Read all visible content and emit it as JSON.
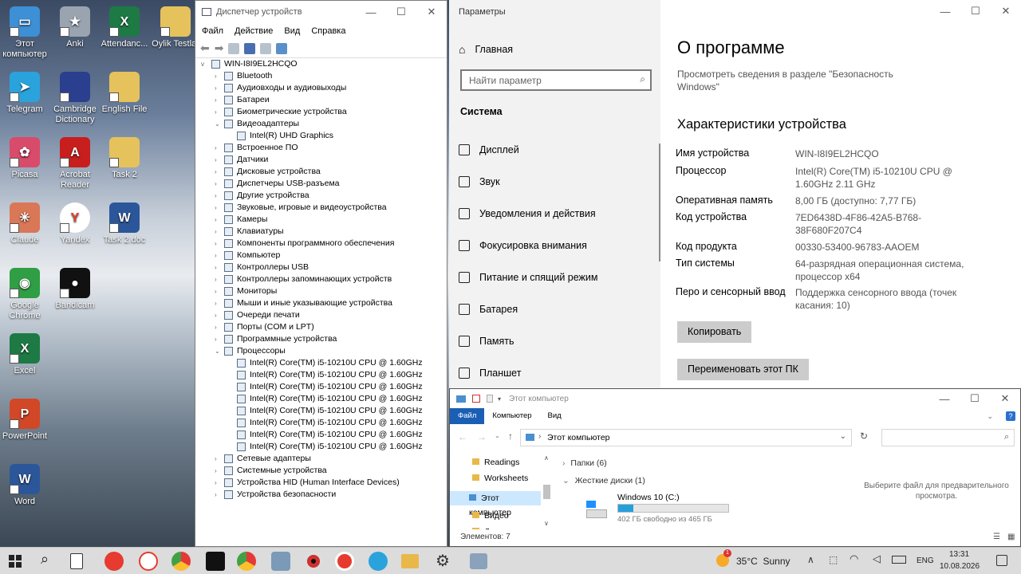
{
  "desktop": {
    "icons": [
      {
        "label": "Этот компьютер",
        "color": "#3d8fd6",
        "glyph": "▭"
      },
      {
        "label": "Anki",
        "color": "#9aa4b0",
        "glyph": "★"
      },
      {
        "label": "Attendanc...",
        "color": "#1d7a44",
        "glyph": "X"
      },
      {
        "label": "Oylik Testlar",
        "color": "#e6c25c",
        "glyph": ""
      },
      {
        "label": "Telegram",
        "color": "#2aa3dd",
        "glyph": "➤"
      },
      {
        "label": "Cambridge Dictionary",
        "color": "#2b3f8f",
        "glyph": ""
      },
      {
        "label": "English File",
        "color": "#e6c25c",
        "glyph": ""
      },
      {
        "label": "Picasa",
        "color": "#d94b6a",
        "glyph": "✿"
      },
      {
        "label": "Acrobat Reader",
        "color": "#c81e1e",
        "glyph": "A"
      },
      {
        "label": "Task 2",
        "color": "#e6c25c",
        "glyph": ""
      },
      {
        "label": "Claude",
        "color": "#d97757",
        "glyph": "✳"
      },
      {
        "label": "Yandex",
        "color": "#ffffff",
        "glyph": "Y"
      },
      {
        "label": "Task 2.doc",
        "color": "#2b579a",
        "glyph": "W"
      },
      {
        "label": "Google Chrome",
        "color": "#2f9e44",
        "glyph": "◉"
      },
      {
        "label": "Bandicam",
        "color": "#111111",
        "glyph": "●"
      },
      {
        "label": "Excel",
        "color": "#1d7a44",
        "glyph": "X"
      },
      {
        "label": "PowerPoint",
        "color": "#d24726",
        "glyph": "P"
      },
      {
        "label": "Word",
        "color": "#2b579a",
        "glyph": "W"
      }
    ]
  },
  "devmgr": {
    "title": "Диспетчер устройств",
    "menu": [
      "Файл",
      "Действие",
      "Вид",
      "Справка"
    ],
    "root": "WIN-I8I9EL2HCQO",
    "items": [
      {
        "text": "Bluetooth",
        "lvl": 1,
        "exp": ">"
      },
      {
        "text": "Аудиовходы и аудиовыходы",
        "lvl": 1,
        "exp": ">"
      },
      {
        "text": "Батареи",
        "lvl": 1,
        "exp": ">"
      },
      {
        "text": "Биометрические устройства",
        "lvl": 1,
        "exp": ">"
      },
      {
        "text": "Видеоадаптеры",
        "lvl": 1,
        "exp": "v"
      },
      {
        "text": "Intel(R) UHD Graphics",
        "lvl": 2,
        "exp": ""
      },
      {
        "text": "Встроенное ПО",
        "lvl": 1,
        "exp": ">"
      },
      {
        "text": "Датчики",
        "lvl": 1,
        "exp": ">"
      },
      {
        "text": "Дисковые устройства",
        "lvl": 1,
        "exp": ">"
      },
      {
        "text": "Диспетчеры USB-разъема",
        "lvl": 1,
        "exp": ">"
      },
      {
        "text": "Другие устройства",
        "lvl": 1,
        "exp": ">"
      },
      {
        "text": "Звуковые, игровые и видеоустройства",
        "lvl": 1,
        "exp": ">"
      },
      {
        "text": "Камеры",
        "lvl": 1,
        "exp": ">"
      },
      {
        "text": "Клавиатуры",
        "lvl": 1,
        "exp": ">"
      },
      {
        "text": "Компоненты программного обеспечения",
        "lvl": 1,
        "exp": ">"
      },
      {
        "text": "Компьютер",
        "lvl": 1,
        "exp": ">"
      },
      {
        "text": "Контроллеры USB",
        "lvl": 1,
        "exp": ">"
      },
      {
        "text": "Контроллеры запоминающих устройств",
        "lvl": 1,
        "exp": ">"
      },
      {
        "text": "Мониторы",
        "lvl": 1,
        "exp": ">"
      },
      {
        "text": "Мыши и иные указывающие устройства",
        "lvl": 1,
        "exp": ">"
      },
      {
        "text": "Очереди печати",
        "lvl": 1,
        "exp": ">"
      },
      {
        "text": "Порты (COM и LPT)",
        "lvl": 1,
        "exp": ">"
      },
      {
        "text": "Программные устройства",
        "lvl": 1,
        "exp": ">"
      },
      {
        "text": "Процессоры",
        "lvl": 1,
        "exp": "v"
      },
      {
        "text": "Intel(R) Core(TM) i5-10210U CPU @ 1.60GHz",
        "lvl": 2,
        "exp": ""
      },
      {
        "text": "Intel(R) Core(TM) i5-10210U CPU @ 1.60GHz",
        "lvl": 2,
        "exp": ""
      },
      {
        "text": "Intel(R) Core(TM) i5-10210U CPU @ 1.60GHz",
        "lvl": 2,
        "exp": ""
      },
      {
        "text": "Intel(R) Core(TM) i5-10210U CPU @ 1.60GHz",
        "lvl": 2,
        "exp": ""
      },
      {
        "text": "Intel(R) Core(TM) i5-10210U CPU @ 1.60GHz",
        "lvl": 2,
        "exp": ""
      },
      {
        "text": "Intel(R) Core(TM) i5-10210U CPU @ 1.60GHz",
        "lvl": 2,
        "exp": ""
      },
      {
        "text": "Intel(R) Core(TM) i5-10210U CPU @ 1.60GHz",
        "lvl": 2,
        "exp": ""
      },
      {
        "text": "Intel(R) Core(TM) i5-10210U CPU @ 1.60GHz",
        "lvl": 2,
        "exp": ""
      },
      {
        "text": "Сетевые адаптеры",
        "lvl": 1,
        "exp": ">"
      },
      {
        "text": "Системные устройства",
        "lvl": 1,
        "exp": ">"
      },
      {
        "text": "Устройства HID (Human Interface Devices)",
        "lvl": 1,
        "exp": ">"
      },
      {
        "text": "Устройства безопасности",
        "lvl": 1,
        "exp": ">"
      }
    ]
  },
  "settings": {
    "title": "Параметры",
    "home": "Главная",
    "search_placeholder": "Найти параметр",
    "section": "Система",
    "nav": [
      "Дисплей",
      "Звук",
      "Уведомления и действия",
      "Фокусировка внимания",
      "Питание и спящий режим",
      "Батарея",
      "Память",
      "Планшет"
    ],
    "page_title": "О программе",
    "security_note": "Просмотреть сведения в разделе \"Безопасность Windows\"",
    "specs_title": "Характеристики устройства",
    "specs": [
      {
        "label": "Имя устройства",
        "value": "WIN-I8I9EL2HCQO"
      },
      {
        "label": "Процессор",
        "value": "Intel(R) Core(TM) i5-10210U CPU @ 1.60GHz   2.11 GHz"
      },
      {
        "label": "Оперативная память",
        "value": "8,00 ГБ (доступно: 7,77 ГБ)"
      },
      {
        "label": "Код устройства",
        "value": "7ED6438D-4F86-42A5-B768-38F680F207C4"
      },
      {
        "label": "Код продукта",
        "value": "00330-53400-96783-AAOEM"
      },
      {
        "label": "Тип системы",
        "value": "64-разрядная операционная система, процессор x64"
      },
      {
        "label": "Перо и сенсорный ввод",
        "value": "Поддержка сенсорного ввода (точек касания: 10)"
      }
    ],
    "copy_btn": "Копировать",
    "rename_btn": "Переименовать этот ПК"
  },
  "explorer": {
    "title": "Этот компьютер",
    "tabs": [
      "Файл",
      "Компьютер",
      "Вид"
    ],
    "address": "Этот компьютер",
    "nav": [
      "Readings",
      "Worksheets",
      "Этот компьютер",
      "Видео",
      "Документы"
    ],
    "folders_group": "Папки (6)",
    "drives_group": "Жесткие диски (1)",
    "drive_name": "Windows 10 (C:)",
    "drive_free": "402 ГБ свободно из 465 ГБ",
    "drive_used_fraction": 0.135,
    "preview_hint": "Выберите файл для предварительного просмотра.",
    "status": "Элементов: 7"
  },
  "taskbar": {
    "badge": "1",
    "weather": "35°C  Sunny",
    "lang": "ENG",
    "time": "13:31",
    "date": "10.08.2026"
  }
}
